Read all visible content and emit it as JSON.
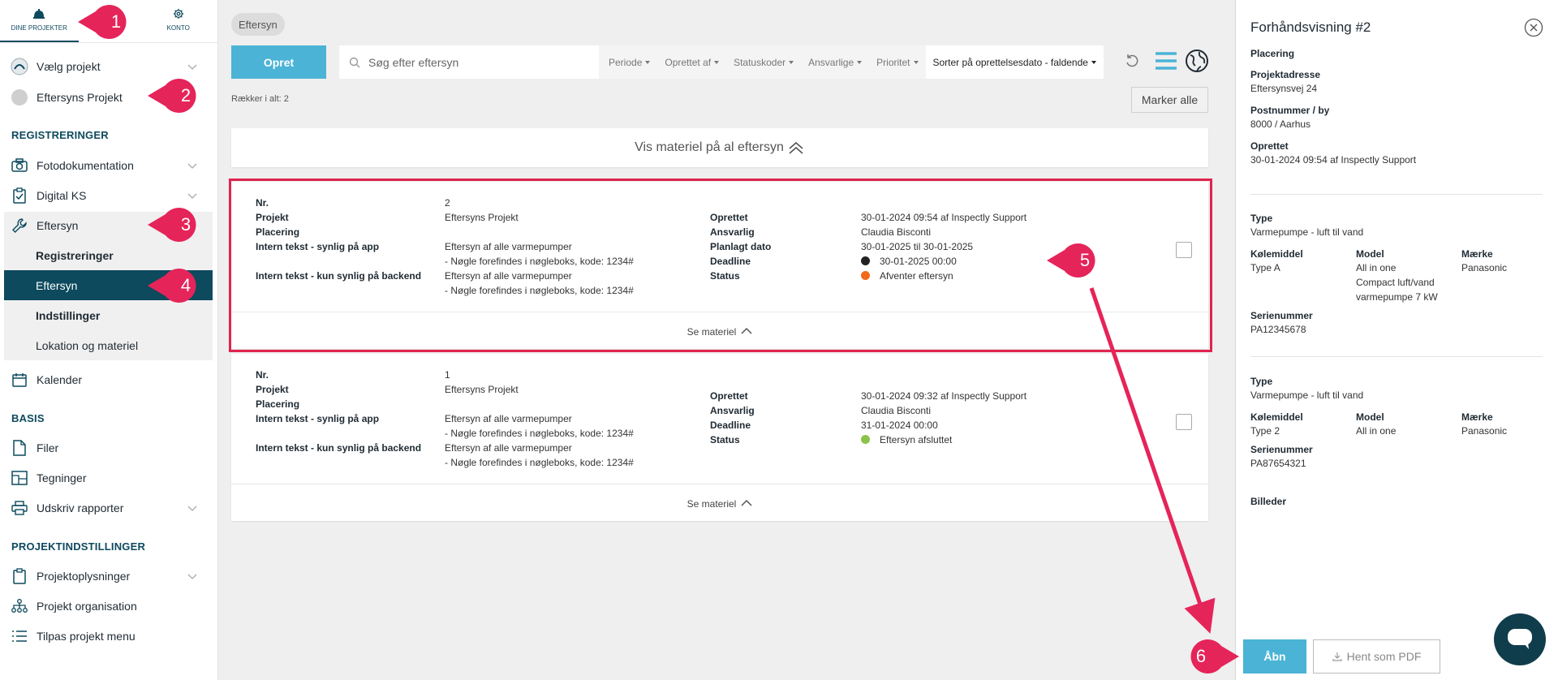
{
  "topnav": {
    "projects_label": "DINE PROJEKTER",
    "account_label": "KONTO"
  },
  "sidebar": {
    "select_project": "Vælg projekt",
    "current_project": "Eftersyns Projekt",
    "section_registrations": "REGISTRERINGER",
    "photo": "Fotodokumentation",
    "digital_ks": "Digital KS",
    "inspection": "Eftersyn",
    "sub_registrations": "Registreringer",
    "sub_inspection": "Eftersyn",
    "sub_settings": "Indstillinger",
    "sub_location": "Lokation og materiel",
    "calendar": "Kalender",
    "section_basis": "BASIS",
    "files": "Filer",
    "drawings": "Tegninger",
    "print_reports": "Udskriv rapporter",
    "section_project_settings": "PROJEKTINDSTILLINGER",
    "project_info": "Projektoplysninger",
    "project_org": "Projekt organisation",
    "customize_menu": "Tilpas projekt menu"
  },
  "main": {
    "chip": "Eftersyn",
    "create_button": "Opret",
    "search_placeholder": "Søg efter eftersyn",
    "filters": [
      "Periode",
      "Oprettet af",
      "Statuskoder",
      "Ansvarlige",
      "Prioritet"
    ],
    "sort_label": "Sorter på oprettelsesdato - faldende",
    "rows_count": "Rækker i alt: 2",
    "mark_all": "Marker alle",
    "show_material_all": "Vis materiel på al eftersyn",
    "see_material": "Se materiel"
  },
  "labels": {
    "nr": "Nr.",
    "project": "Projekt",
    "placement": "Placering",
    "internal_app": "Intern tekst - synlig på app",
    "internal_backend": "Intern tekst - kun synlig på backend",
    "created": "Oprettet",
    "responsible": "Ansvarlig",
    "planned": "Planlagt dato",
    "deadline": "Deadline",
    "status": "Status"
  },
  "cards": [
    {
      "nr": "2",
      "project": "Eftersyns Projekt",
      "internal_app_1": "Eftersyn af alle varmepumper",
      "internal_app_2": "- Nøgle forefindes i nøgleboks, kode: 1234#",
      "internal_backend_1": "Eftersyn af alle varmepumper",
      "internal_backend_2": "- Nøgle forefindes i nøgleboks, kode: 1234#",
      "created": "30-01-2024 09:54 af Inspectly Support",
      "responsible": "Claudia Bisconti",
      "planned": "30-01-2025 til 30-01-2025",
      "deadline": "30-01-2025 00:00",
      "status": "Afventer eftersyn",
      "status_color": "#f26b1d",
      "deadline_color": "#222222"
    },
    {
      "nr": "1",
      "project": "Eftersyns Projekt",
      "internal_app_1": "Eftersyn af alle varmepumper",
      "internal_app_2": "- Nøgle forefindes i nøgleboks, kode: 1234#",
      "internal_backend_1": "Eftersyn af alle varmepumper",
      "internal_backend_2": "- Nøgle forefindes i nøgleboks, kode: 1234#",
      "created": "30-01-2024 09:32 af Inspectly Support",
      "responsible": "Claudia Bisconti",
      "deadline": "31-01-2024 00:00",
      "status": "Eftersyn afsluttet",
      "status_color": "#8bc34a"
    }
  ],
  "preview": {
    "title": "Forhåndsvisning #2",
    "placement_label": "Placering",
    "address_label": "Projektadresse",
    "address": "Eftersynsvej 24",
    "postal_label": "Postnummer / by",
    "postal": "8000 / Aarhus",
    "created_label": "Oprettet",
    "created": "30-01-2024 09:54 af Inspectly Support",
    "type_label": "Type",
    "coolant_label": "Kølemiddel",
    "model_label": "Model",
    "brand_label": "Mærke",
    "serial_label": "Serienummer",
    "item1": {
      "type": "Varmepumpe - luft til vand",
      "coolant": "Type A",
      "model_1": "All in one",
      "model_2": "Compact luft/vand",
      "model_3": "varmepumpe 7 kW",
      "brand": "Panasonic",
      "serial": "PA12345678"
    },
    "item2": {
      "type": "Varmepumpe - luft til vand",
      "coolant": "Type 2",
      "model": "All in one",
      "brand": "Panasonic",
      "serial": "PA87654321"
    },
    "images_label": "Billeder",
    "open_button": "Åbn",
    "pdf_button": "Hent som PDF"
  },
  "callouts": [
    "1",
    "2",
    "3",
    "4",
    "5",
    "6"
  ],
  "colors": {
    "accent": "#4ab3d6",
    "primary_dark": "#0d4a5e",
    "callout": "#e5245a"
  }
}
